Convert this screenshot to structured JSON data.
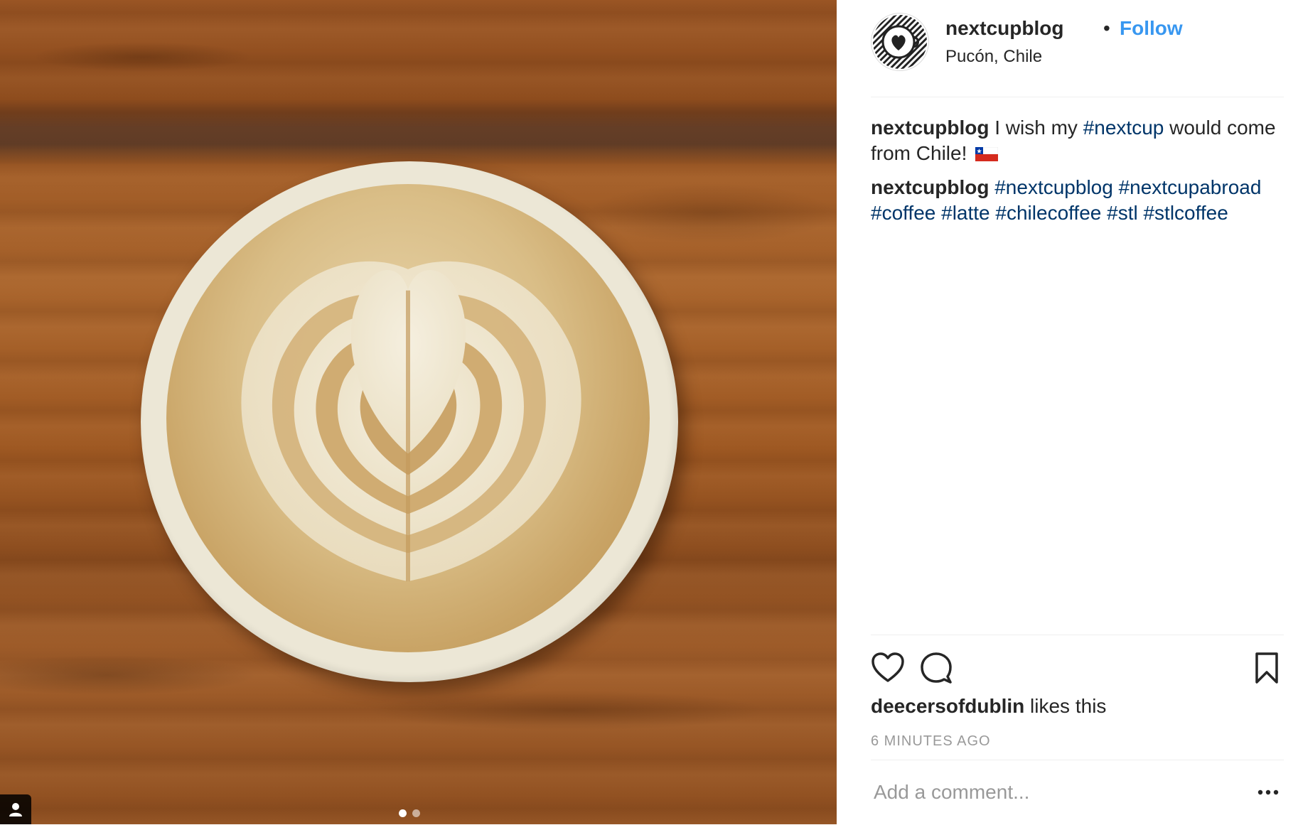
{
  "post": {
    "username": "nextcupblog",
    "separator": "•",
    "follow_label": "Follow",
    "location": "Pucón, Chile",
    "caption": {
      "username": "nextcupblog",
      "text_before": "I wish my",
      "hashtag": "#nextcup",
      "text_after": "would come from Chile!",
      "flag_icon": "chile-flag-icon"
    },
    "comment": {
      "username": "nextcupblog",
      "hashtags": [
        "#nextcupblog",
        "#nextcupabroad",
        "#coffee",
        "#latte",
        "#chilecoffee",
        "#stl",
        "#stlcoffee"
      ]
    },
    "likes": {
      "username": "deecersofdublin",
      "suffix": "likes this"
    },
    "timestamp": "6 MINUTES AGO",
    "comment_placeholder": "Add a comment...",
    "carousel": {
      "count": 2,
      "active_index": 0
    },
    "icons": {
      "like": "heart-icon",
      "comment": "comment-bubble-icon",
      "save": "bookmark-icon",
      "more": "more-options-icon",
      "user_tag": "user-tag-icon"
    },
    "colors": {
      "link": "#3897f0",
      "hashtag": "#003569",
      "text": "#262626",
      "muted": "#999999",
      "divider": "#efefef"
    }
  }
}
